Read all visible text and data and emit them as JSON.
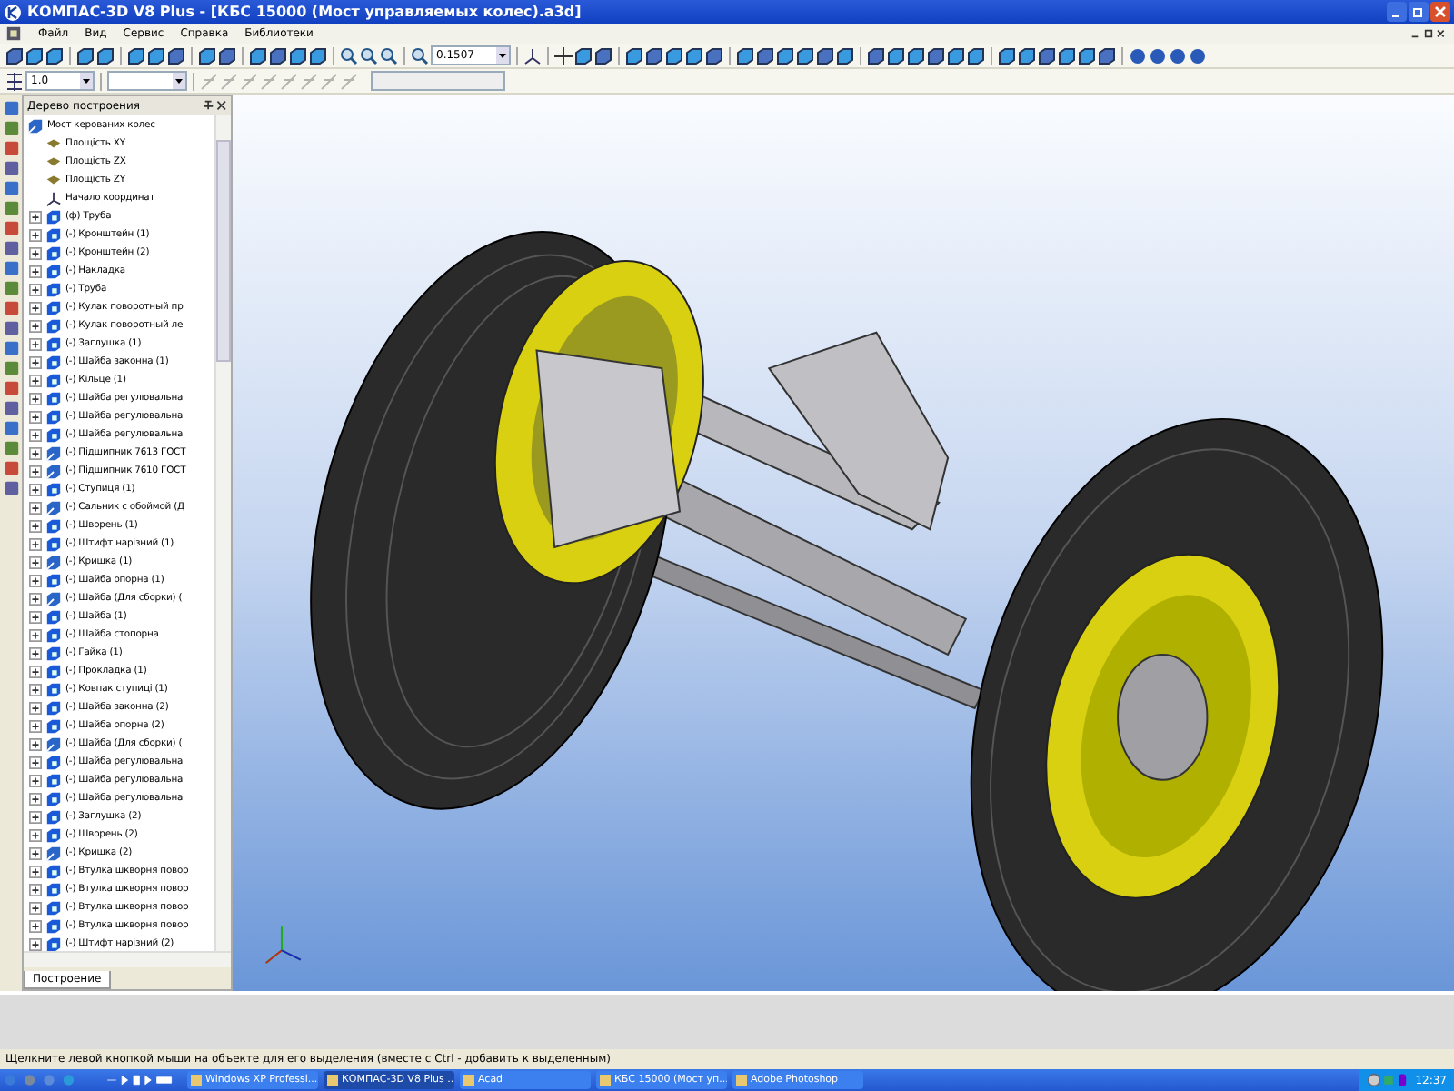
{
  "window": {
    "title": "КОМПАС-3D V8 Plus - [КБС 15000 (Мост управляемых колес).a3d]"
  },
  "menu": [
    "Файл",
    "Вид",
    "Сервис",
    "Справка",
    "Библиотеки"
  ],
  "toolbar": {
    "scale": "0.1507",
    "step": "1.0"
  },
  "tree": {
    "title": "Дерево построения",
    "tab": "Построение",
    "root": {
      "label": "Мост керованих колес",
      "kind": "assembly",
      "children": [
        {
          "label": "Площість XY",
          "kind": "plane"
        },
        {
          "label": "Площість ZX",
          "kind": "plane"
        },
        {
          "label": "Площість ZY",
          "kind": "plane"
        },
        {
          "label": "Начало координат",
          "kind": "origin"
        },
        {
          "label": "(ф) Труба",
          "kind": "part",
          "expanded": false
        },
        {
          "label": "(-) Кронштейн (1)",
          "kind": "part",
          "expanded": false
        },
        {
          "label": "(-) Кронштейн (2)",
          "kind": "part",
          "expanded": false
        },
        {
          "label": "(-) Накладка",
          "kind": "part",
          "expanded": false
        },
        {
          "label": "(-) Труба",
          "kind": "part",
          "expanded": false
        },
        {
          "label": "(-) Кулак поворотный пр",
          "kind": "part",
          "expanded": false
        },
        {
          "label": "(-) Кулак поворотный ле",
          "kind": "part",
          "expanded": false
        },
        {
          "label": "(-) Заглушка (1)",
          "kind": "part",
          "expanded": false
        },
        {
          "label": "(-) Шайба законна (1)",
          "kind": "part",
          "expanded": false
        },
        {
          "label": "(-) Кільце (1)",
          "kind": "part",
          "expanded": false
        },
        {
          "label": "(-) Шайба регулювальна",
          "kind": "part",
          "expanded": false
        },
        {
          "label": "(-) Шайба регулювальна",
          "kind": "part",
          "expanded": false
        },
        {
          "label": "(-) Шайба регулювальна",
          "kind": "part",
          "expanded": false
        },
        {
          "label": "(-) Підшипник 7613 ГОСТ",
          "kind": "assembly",
          "expanded": false
        },
        {
          "label": "(-) Підшипник 7610 ГОСТ",
          "kind": "assembly",
          "expanded": false
        },
        {
          "label": "(-) Ступиця (1)",
          "kind": "part",
          "expanded": false
        },
        {
          "label": "(-) Сальник с обоймой (Д",
          "kind": "assembly",
          "expanded": false
        },
        {
          "label": "(-) Шворень (1)",
          "kind": "part",
          "expanded": false
        },
        {
          "label": "(-) Штифт нарізний (1)",
          "kind": "part",
          "expanded": false
        },
        {
          "label": "(-) Кришка (1)",
          "kind": "assembly",
          "expanded": false
        },
        {
          "label": "(-) Шайба опорна (1)",
          "kind": "part",
          "expanded": false
        },
        {
          "label": "(-) Шайба (Для сборки) (",
          "kind": "assembly",
          "expanded": false
        },
        {
          "label": "(-) Шайба (1)",
          "kind": "part",
          "expanded": false
        },
        {
          "label": "(-) Шайба стопорна",
          "kind": "part",
          "expanded": false
        },
        {
          "label": "(-) Гайка (1)",
          "kind": "part",
          "expanded": false
        },
        {
          "label": "(-) Прокладка (1)",
          "kind": "part",
          "expanded": false
        },
        {
          "label": "(-) Ковпак ступиці (1)",
          "kind": "part",
          "expanded": false
        },
        {
          "label": "(-) Шайба законна (2)",
          "kind": "part",
          "expanded": false
        },
        {
          "label": "(-) Шайба опорна (2)",
          "kind": "part",
          "expanded": false
        },
        {
          "label": "(-) Шайба (Для сборки) (",
          "kind": "assembly",
          "expanded": false
        },
        {
          "label": "(-) Шайба регулювальна",
          "kind": "part",
          "expanded": false
        },
        {
          "label": "(-) Шайба регулювальна",
          "kind": "part",
          "expanded": false
        },
        {
          "label": "(-) Шайба регулювальна",
          "kind": "part",
          "expanded": false
        },
        {
          "label": "(-) Заглушка (2)",
          "kind": "part",
          "expanded": false
        },
        {
          "label": "(-) Шворень (2)",
          "kind": "part",
          "expanded": false
        },
        {
          "label": "(-) Кришка (2)",
          "kind": "assembly",
          "expanded": false
        },
        {
          "label": "(-) Втулка шкворня повор",
          "kind": "part",
          "expanded": false
        },
        {
          "label": "(-) Втулка шкворня повор",
          "kind": "part",
          "expanded": false
        },
        {
          "label": "(-) Втулка шкворня повор",
          "kind": "part",
          "expanded": false
        },
        {
          "label": "(-) Втулка шкворня повор",
          "kind": "part",
          "expanded": false
        },
        {
          "label": "(-) Штифт нарізний (2)",
          "kind": "part",
          "expanded": false
        }
      ]
    }
  },
  "status_bar": "Щелкните левой кнопкой мыши на объекте для его выделения (вместе с Ctrl - добавить к выделенным)",
  "taskbar": {
    "items": [
      {
        "label": "Windows XP Professi...",
        "selected": false
      },
      {
        "label": "КОМПАС-3D V8 Plus ...",
        "selected": true
      },
      {
        "label": "Acad",
        "selected": false
      },
      {
        "label": "КБС 15000 (Мост уп...",
        "selected": false
      },
      {
        "label": "Adobe Photoshop",
        "selected": false
      }
    ],
    "clock": "12:37"
  }
}
